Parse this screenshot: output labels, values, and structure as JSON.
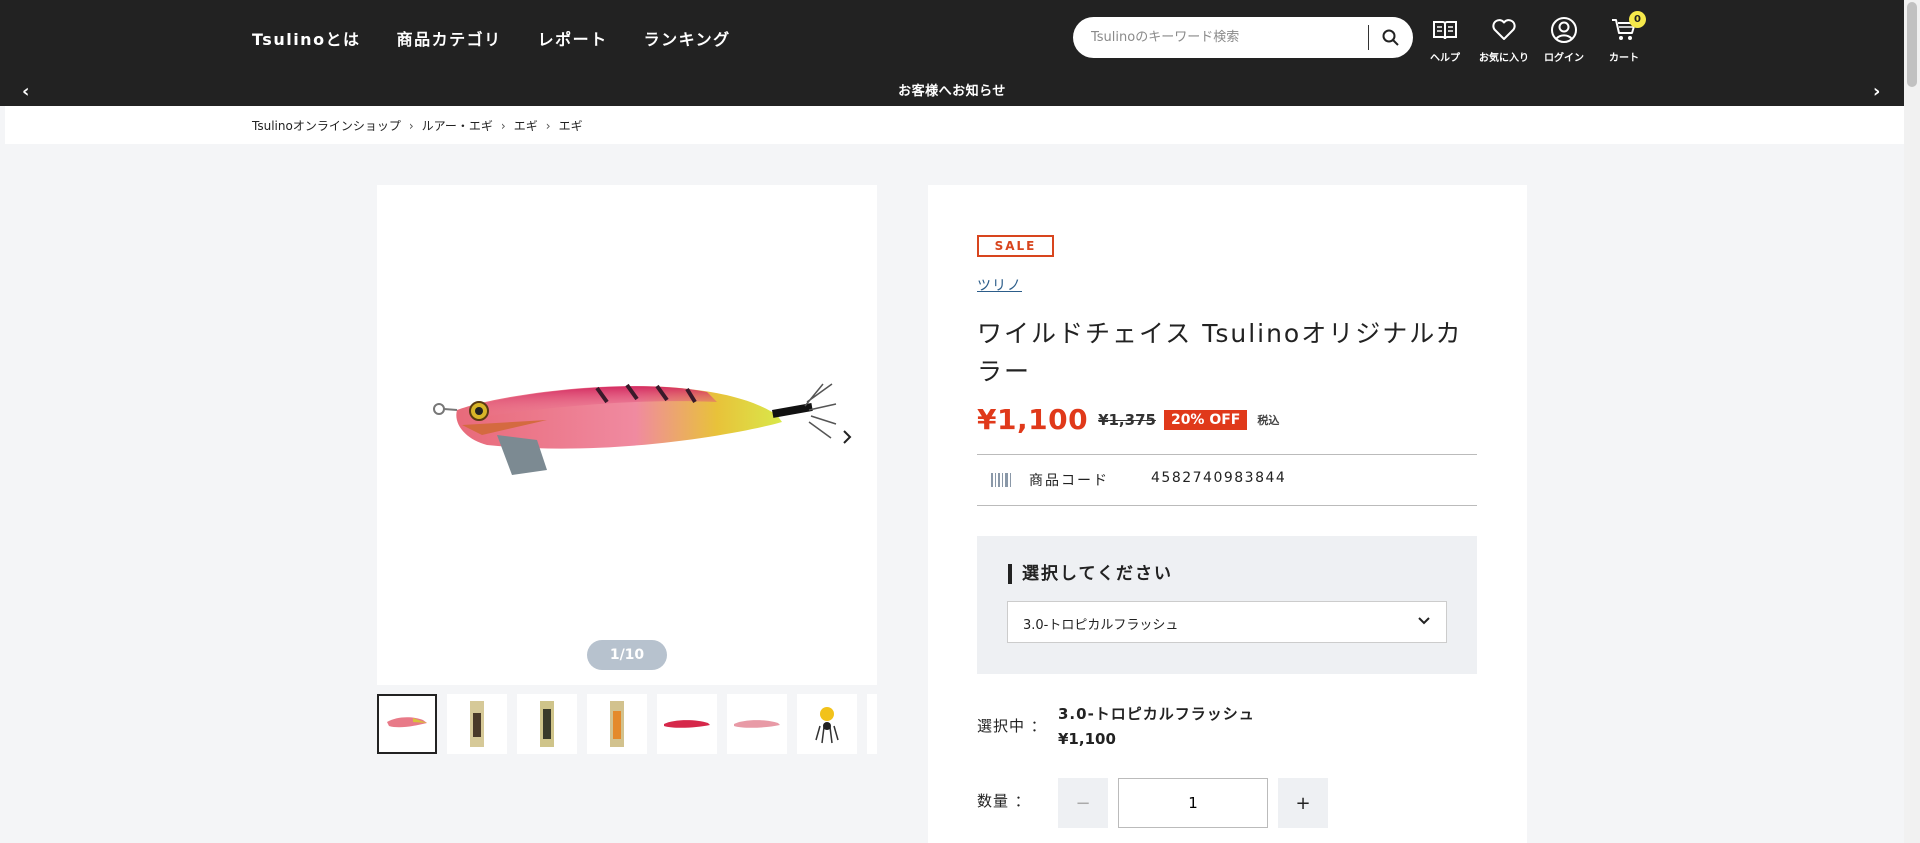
{
  "header": {
    "nav": [
      "Tsulinoとは",
      "商品カテゴリ",
      "レポート",
      "ランキング"
    ],
    "search_placeholder": "Tsulinoのキーワード検索",
    "icons": [
      {
        "name": "help-icon",
        "label": "ヘルプ"
      },
      {
        "name": "heart-icon",
        "label": "お気に入り"
      },
      {
        "name": "user-icon",
        "label": "ログイン"
      },
      {
        "name": "cart-icon",
        "label": "カート"
      }
    ],
    "cart_count": "0",
    "notice": "お客様へお知らせ",
    "prev_arrow": "‹",
    "next_arrow": "›"
  },
  "breadcrumb": [
    "Tsulinoオンラインショップ",
    "ルアー・エギ",
    "エギ",
    "エギ"
  ],
  "gallery": {
    "pager": "1/10",
    "thumb_count": 8
  },
  "product": {
    "badge": "SALE",
    "brand": "ツリノ",
    "title": "ワイルドチェイス Tsulinoオリジナルカラー",
    "price": "¥1,100",
    "old_price": "¥1,375",
    "discount": "20% OFF",
    "tax": "税込",
    "code_label": "商品コード",
    "code_value": "4582740983844",
    "select_heading": "選択してください",
    "select_value": "3.0-トロピカルフラッシュ",
    "selected_label": "選択中 ：",
    "selected_name": "3.0-トロピカルフラッシュ",
    "selected_price": "¥1,100",
    "qty_label": "数量 ：",
    "qty_value": "1",
    "minus": "−",
    "plus": "+"
  },
  "colors": {
    "header_bg": "#222222",
    "accent_red": "#e0391a",
    "cart_badge": "#f5e94b",
    "brand_link": "#2c5d8a"
  }
}
